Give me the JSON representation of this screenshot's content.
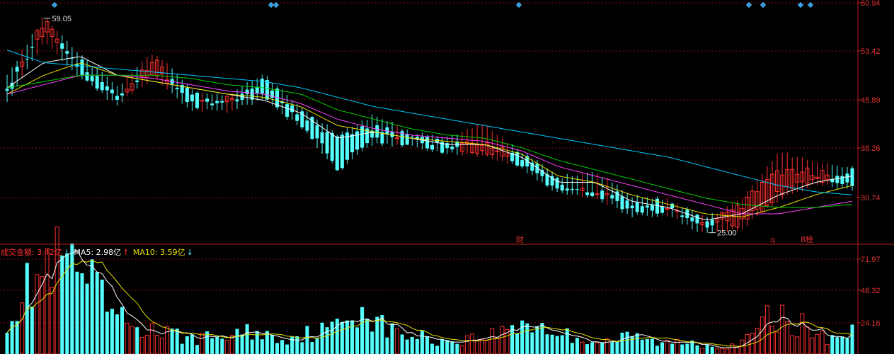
{
  "chart_data": [
    {
      "type": "candlestick",
      "y_ticks": [
        "60.94",
        "53.42",
        "45.89",
        "38.26",
        "30.74"
      ],
      "ylim": [
        23.5,
        61.5
      ],
      "high_label": "59.05",
      "low_label": "25.00",
      "event_markers": [
        "财",
        "q",
        "8榜"
      ],
      "ma_colors": {
        "ma5": "#ffffff",
        "ma10": "#e8e000",
        "ma20": "#ff40ff",
        "ma30": "#00d000",
        "ma60": "#00c8ff"
      },
      "up_color": "#ff3030",
      "down_color": "#54ffff",
      "key_points": [
        {
          "o": 48.5,
          "c": 47.0,
          "h": 49.5,
          "l": 45.8
        },
        {
          "o": 56.5,
          "c": 58.5,
          "h": 59.05,
          "l": 55.5
        },
        {
          "o": 52.0,
          "c": 50.5,
          "h": 53.0,
          "l": 49.8
        },
        {
          "o": 47.0,
          "c": 46.2,
          "h": 47.8,
          "l": 45.5
        },
        {
          "o": 50.5,
          "c": 52.5,
          "h": 53.5,
          "l": 50.0
        },
        {
          "o": 47.0,
          "c": 45.5,
          "h": 47.5,
          "l": 44.8
        },
        {
          "o": 45.0,
          "c": 46.0,
          "h": 46.5,
          "l": 44.5
        },
        {
          "o": 49.0,
          "c": 47.0,
          "h": 50.0,
          "l": 46.5
        },
        {
          "o": 44.0,
          "c": 42.5,
          "h": 44.5,
          "l": 42.0
        },
        {
          "o": 40.0,
          "c": 35.5,
          "h": 40.5,
          "l": 35.0
        },
        {
          "o": 42.0,
          "c": 40.0,
          "h": 43.5,
          "l": 39.5
        },
        {
          "o": 40.0,
          "c": 39.5,
          "h": 40.5,
          "l": 39.0
        },
        {
          "o": 39.0,
          "c": 38.2,
          "h": 40.0,
          "l": 37.8
        },
        {
          "o": 38.0,
          "c": 39.5,
          "h": 42.0,
          "l": 37.5
        },
        {
          "o": 37.0,
          "c": 36.0,
          "h": 37.5,
          "l": 35.5
        },
        {
          "o": 33.0,
          "c": 32.0,
          "h": 33.5,
          "l": 31.5
        },
        {
          "o": 32.0,
          "c": 31.5,
          "h": 34.5,
          "l": 31.0
        },
        {
          "o": 30.0,
          "c": 28.5,
          "h": 30.5,
          "l": 28.0
        },
        {
          "o": 29.5,
          "c": 28.5,
          "h": 30.0,
          "l": 28.0
        },
        {
          "o": 26.5,
          "c": 25.8,
          "h": 27.0,
          "l": 25.0
        },
        {
          "o": 26.5,
          "c": 29.5,
          "h": 30.0,
          "l": 26.0
        },
        {
          "o": 31.0,
          "c": 35.0,
          "h": 37.5,
          "l": 30.5
        },
        {
          "o": 33.5,
          "c": 34.5,
          "h": 36.0,
          "l": 33.0
        },
        {
          "o": 34.5,
          "c": 33.0,
          "h": 35.0,
          "l": 32.0
        }
      ],
      "ma_key_points": {
        "ma5": [
          48,
          52,
          53,
          50,
          49,
          48,
          47,
          46,
          44,
          40,
          41,
          40,
          39,
          39,
          37,
          33,
          33,
          30,
          29,
          27,
          28,
          31,
          33,
          34
        ],
        "ma10": [
          47,
          50,
          52,
          50,
          49,
          48,
          47,
          46.5,
          45,
          42,
          41,
          40,
          39.5,
          39,
          37.5,
          34,
          33,
          31,
          29.5,
          28,
          27.5,
          29,
          31,
          32.5
        ],
        "ma20": [
          47,
          48.5,
          50,
          50,
          49.5,
          48.5,
          47.5,
          47,
          45.5,
          43,
          41.5,
          40.5,
          40,
          39.5,
          38,
          35.5,
          34,
          32.5,
          31,
          29.5,
          28,
          28,
          29,
          30
        ],
        "ma30": [
          48,
          49,
          50,
          50,
          50,
          49.5,
          48.5,
          48,
          47,
          44.5,
          43,
          41.5,
          40.5,
          40,
          38.5,
          36.5,
          35,
          33.5,
          32,
          30.5,
          29.5,
          29,
          29,
          29.5
        ],
        "ma60": [
          54,
          52,
          51.5,
          51,
          50.5,
          50,
          49.5,
          49,
          48,
          46.5,
          45,
          44,
          43,
          42,
          41,
          40,
          39,
          38,
          37,
          35.5,
          34,
          32.5,
          31.5,
          31
        ]
      }
    },
    {
      "type": "bar",
      "legend": {
        "amount_label": "成交金额: 3.42亿",
        "amount_arrow": "↓",
        "ma5_label": "MA5: 2.98亿",
        "ma5_arrow": "↑",
        "ma10_label": "MA10: 3.59亿",
        "ma10_arrow": "↓"
      },
      "y_ticks": [
        "71.97",
        "48.32",
        "24.16"
      ],
      "ylim": [
        0,
        80
      ],
      "bar_colors": {
        "up": "#ff3030",
        "down": "#54ffff"
      },
      "ma_colors": {
        "ma5": "#ffffff",
        "ma10": "#e8e000"
      },
      "key_values": [
        30,
        58,
        72,
        55,
        28,
        20,
        15,
        12,
        14,
        18,
        12,
        16,
        20,
        38,
        18,
        14,
        10,
        12,
        16,
        26,
        18,
        12,
        10,
        14,
        8,
        10,
        6,
        8,
        30,
        24,
        12,
        18
      ]
    }
  ]
}
